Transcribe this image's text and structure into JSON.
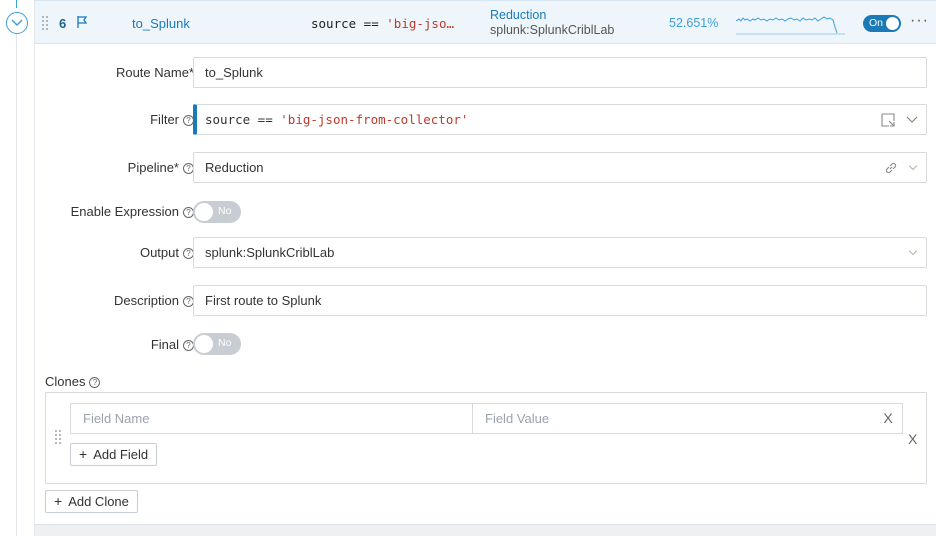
{
  "route_header": {
    "index": "6",
    "name": "to_Splunk",
    "filter_prefix": "source == ",
    "filter_value": "'big-jso…",
    "pipeline": "Reduction",
    "output": "splunk:SplunkCriblLab",
    "percentage": "52.651%",
    "toggle_label": "On",
    "more_label": "···"
  },
  "form": {
    "route_name_label": "Route Name*",
    "route_name_value": "to_Splunk",
    "filter_label": "Filter",
    "filter_prefix": "source == ",
    "filter_value": "'big-json-from-collector'",
    "pipeline_label": "Pipeline*",
    "pipeline_value": "Reduction",
    "enable_expression_label": "Enable Expression",
    "enable_expression_toggle": "No",
    "output_label": "Output",
    "output_value": "splunk:SplunkCriblLab",
    "description_label": "Description",
    "description_value": "First route to Splunk",
    "final_label": "Final",
    "final_toggle": "No"
  },
  "clones": {
    "label": "Clones",
    "field_name_placeholder": "Field Name",
    "field_value_placeholder": "Field Value",
    "remove_field": "X",
    "remove_clone": "X",
    "add_field_label": "Add Field",
    "add_clone_label": "Add Clone"
  },
  "icons": {
    "help": "?",
    "plus": "+"
  },
  "colors": {
    "accent": "#1a7ab8",
    "header_bg": "#eef6fc",
    "string_literal": "#c0392b"
  }
}
